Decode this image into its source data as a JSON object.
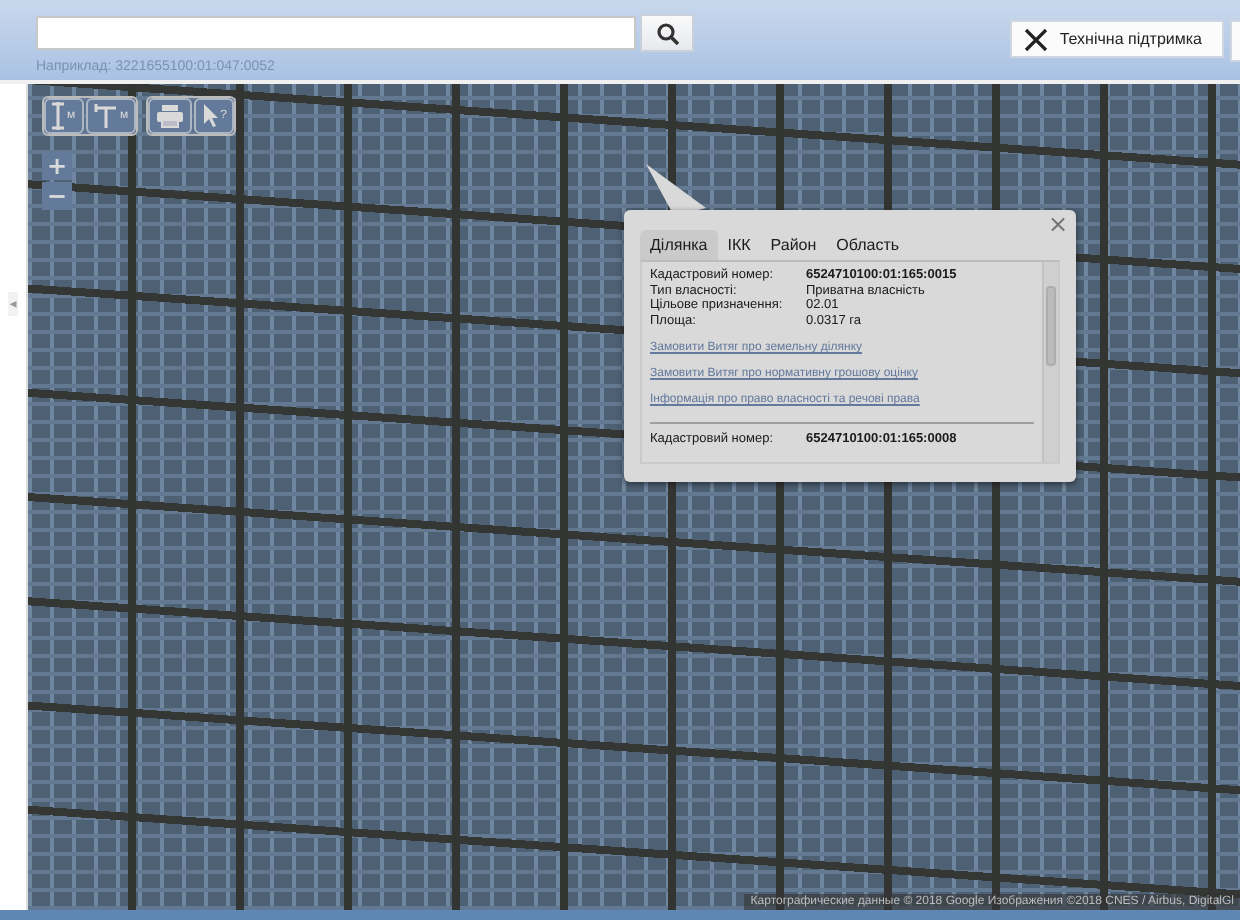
{
  "search": {
    "hint": "Наприклад: 3221655100:01:047:0052"
  },
  "support_button": {
    "label": "Технічна підтримка"
  },
  "map_tools": [
    {
      "kind": "measure_length",
      "label": "м"
    },
    {
      "kind": "measure_area",
      "label": "м"
    },
    {
      "kind": "print"
    },
    {
      "kind": "identify",
      "label": "?"
    }
  ],
  "zoom": {
    "in": "+",
    "out": "−"
  },
  "side_toggle": "◂",
  "popup": {
    "close": "×",
    "tabs": [
      {
        "label": "Ділянка",
        "selected": true
      },
      {
        "label": "ІКК",
        "selected": false
      },
      {
        "label": "Район",
        "selected": false
      },
      {
        "label": "Область",
        "selected": false
      }
    ],
    "parcels": [
      {
        "number_label": "Кадастровий номер:",
        "number": "6524710100:01:165:0015",
        "fields": [
          {
            "label": "Тип власності:",
            "value": "Приватна власність"
          },
          {
            "label": "Цільове призначення:",
            "value": "02.01"
          },
          {
            "label": "Площа:",
            "value": "0.0317 га"
          }
        ],
        "links": [
          "Замовити Витяг про земельну ділянку",
          "Замовити Витяг про нормативну грошову оцінку",
          "Інформація про право власності та речові права"
        ]
      },
      {
        "number_label": "Кадастровий номер:",
        "number": "6524710100:01:165:0008"
      }
    ]
  },
  "attribution": "Картографические данные © 2018 Google Изображения ©2018 CNES / Airbus, DigitalGl"
}
